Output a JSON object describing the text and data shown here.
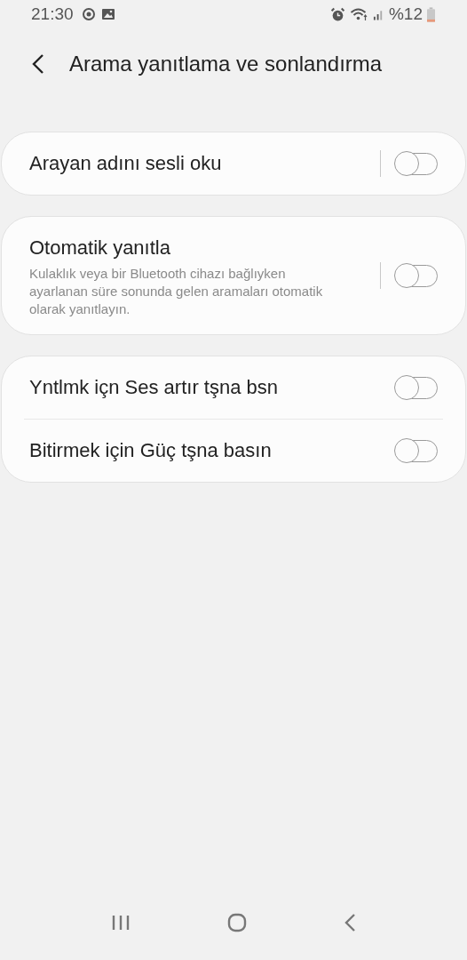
{
  "status_bar": {
    "time": "21:30",
    "battery": "%12"
  },
  "header": {
    "title": "Arama yanıtlama ve sonlandırma"
  },
  "groups": [
    {
      "items": [
        {
          "title": "Arayan adını sesli oku",
          "separator": true,
          "on": false
        }
      ]
    },
    {
      "items": [
        {
          "title": "Otomatik yanıtla",
          "description": "Kulaklık veya bir Bluetooth cihazı bağlıyken ayarlanan süre sonunda gelen aramaları otomatik olarak yanıtlayın.",
          "separator": true,
          "on": false
        }
      ]
    },
    {
      "items": [
        {
          "title": "Yntlmk içn Ses artır tşna bsn",
          "separator": false,
          "on": false
        },
        {
          "title": "Bitirmek için Güç tşna basın",
          "separator": false,
          "on": false
        }
      ]
    }
  ]
}
